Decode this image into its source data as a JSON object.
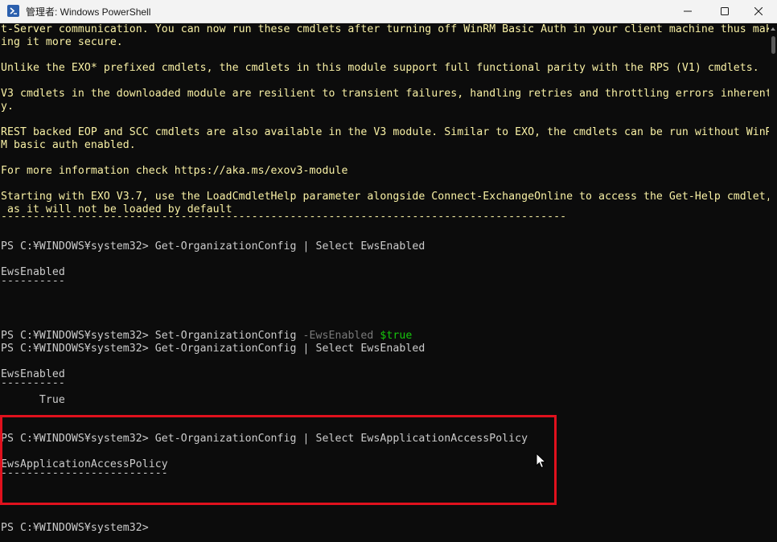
{
  "window": {
    "title": "管理者: Windows PowerShell",
    "icons": {
      "app": "powershell-icon",
      "minimize": "minimize-icon",
      "maximize": "maximize-icon",
      "close": "close-icon"
    }
  },
  "console": {
    "lines": [
      "t-Server communication. You can now run these cmdlets after turning off WinRM Basic Auth in your client machine thus mak",
      "ing it more secure.",
      "",
      "Unlike the EXO* prefixed cmdlets, the cmdlets in this module support full functional parity with the RPS (V1) cmdlets.",
      "",
      "V3 cmdlets in the downloaded module are resilient to transient failures, handling retries and throttling errors inherentl",
      "y.",
      "",
      "REST backed EOP and SCC cmdlets are also available in the V3 module. Similar to EXO, the cmdlets can be run without WinR",
      "M basic auth enabled.",
      "",
      "For more information check https://aka.ms/exov3-module",
      "",
      "Starting with EXO V3.7, use the LoadCmdletHelp parameter alongside Connect-ExchangeOnline to access the Get-Help cmdlet,",
      " as it will not be loaded by default",
      "----------------------------------------------------------------------------------------",
      "",
      "PS C:¥WINDOWS¥system32> Get-OrganizationConfig | Select EwsEnabled",
      "",
      "EwsEnabled",
      "----------",
      "",
      "",
      "",
      "PS C:¥WINDOWS¥system32> ",
      "PS C:¥WINDOWS¥system32> Get-OrganizationConfig | Select EwsEnabled",
      "",
      "EwsEnabled",
      "----------",
      "      True",
      "",
      "",
      "PS C:¥WINDOWS¥system32> Get-OrganizationConfig | Select EwsApplicationAccessPolicy",
      "",
      "EwsApplicationAccessPolicy",
      "--------------------------",
      "",
      "",
      "",
      "",
      "PS C:¥WINDOWS¥system32>"
    ],
    "set_command": {
      "prompt": "PS C:¥WINDOWS¥system32> ",
      "cmdlet": "Set-OrganizationConfig",
      "param": " -EwsEnabled ",
      "value": "$true"
    }
  },
  "colors": {
    "banner_text": "#f9f1a5",
    "normal_text": "#cccccc",
    "parameter": "#7a7a7a",
    "variable": "#16c60c",
    "highlight_box": "#e0111d"
  }
}
